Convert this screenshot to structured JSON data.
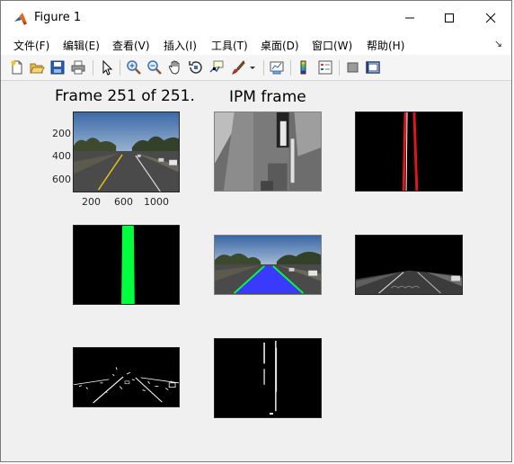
{
  "window": {
    "title": "Figure 1",
    "controls": {
      "minimize": "minimize-icon",
      "maximize": "maximize-icon",
      "close": "close-icon"
    }
  },
  "menu": {
    "items": [
      "文件(F)",
      "编辑(E)",
      "查看(V)",
      "插入(I)",
      "工具(T)",
      "桌面(D)",
      "窗口(W)",
      "帮助(H)"
    ],
    "overflow": "↘"
  },
  "toolbar": {
    "icons": [
      "new-figure-icon",
      "open-file-icon",
      "save-icon",
      "print-icon",
      "select-arrow-icon",
      "zoom-in-icon",
      "zoom-out-icon",
      "pan-hand-icon",
      "rotate-3d-icon",
      "data-cursor-icon",
      "brush-icon",
      "dropdown-arrow-icon",
      "link-plot-icon",
      "colorbar-icon",
      "legend-icon",
      "hide-plot-tools-icon",
      "show-plot-tools-icon"
    ]
  },
  "figure": {
    "frame_label": "Frame  251 of 251.",
    "ipm_label": "IPM frame",
    "yticks": [
      "200",
      "400",
      "600"
    ],
    "xticks": [
      "200",
      "600",
      "1000"
    ]
  },
  "colors": {
    "lane_red": "#e0161b",
    "lane_green": "#00ff3c",
    "lane_fill_blue": "#3a3aff",
    "sky_blue": "#4d78b3"
  }
}
